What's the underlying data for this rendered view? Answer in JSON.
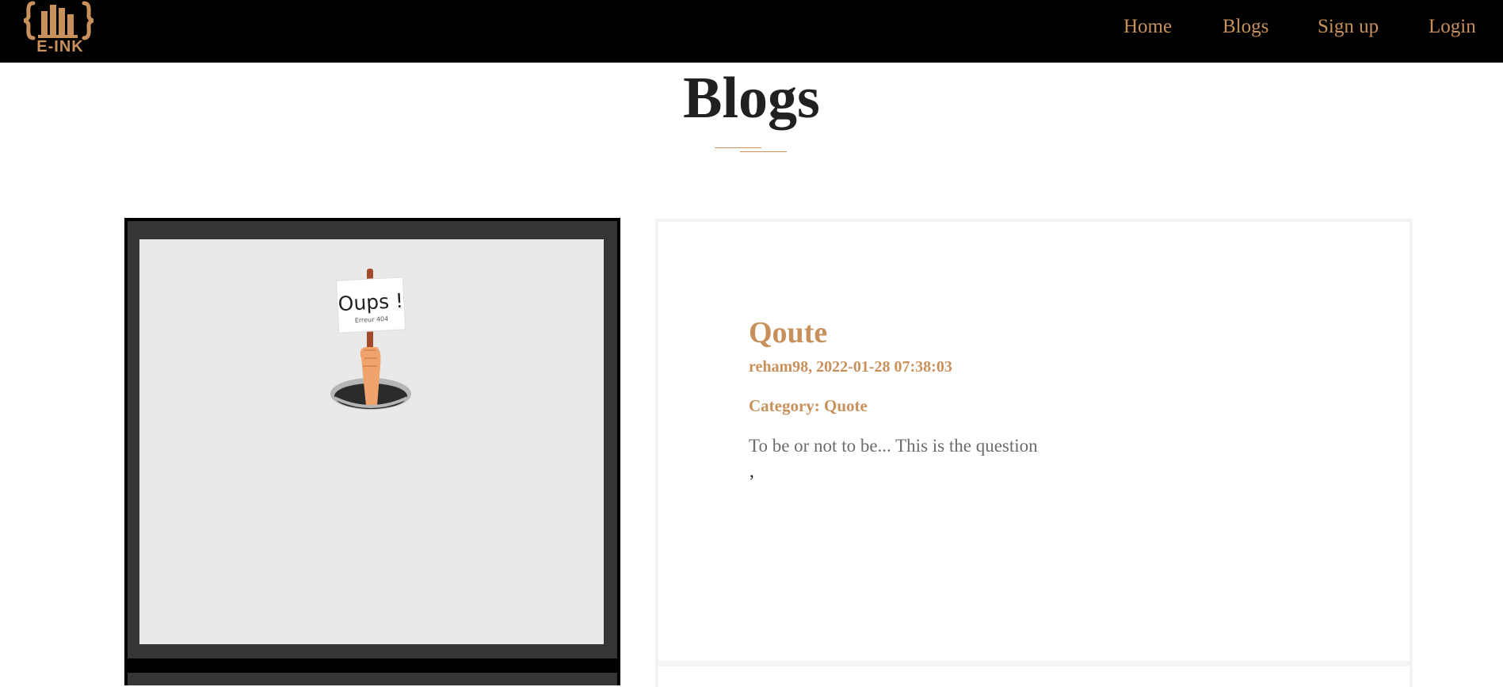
{
  "navbar": {
    "logo_text": "E-INK",
    "links": [
      "Home",
      "Blogs",
      "Sign up",
      "Login"
    ]
  },
  "header": {
    "title": "Blogs"
  },
  "post": {
    "image_sign_text": "Oups !",
    "image_sign_subtext": "Erreur 404",
    "title": "Qoute",
    "meta": "reham98, 2022-01-28 07:38:03",
    "category": "Category: Quote",
    "body": "To be or not to be... This is the question",
    "trailing": ","
  },
  "colors": {
    "accent": "#c8915c",
    "navbar_bg": "#000000",
    "title": "#212121",
    "frame": "#353535",
    "image_bg": "#e9e9e9"
  }
}
